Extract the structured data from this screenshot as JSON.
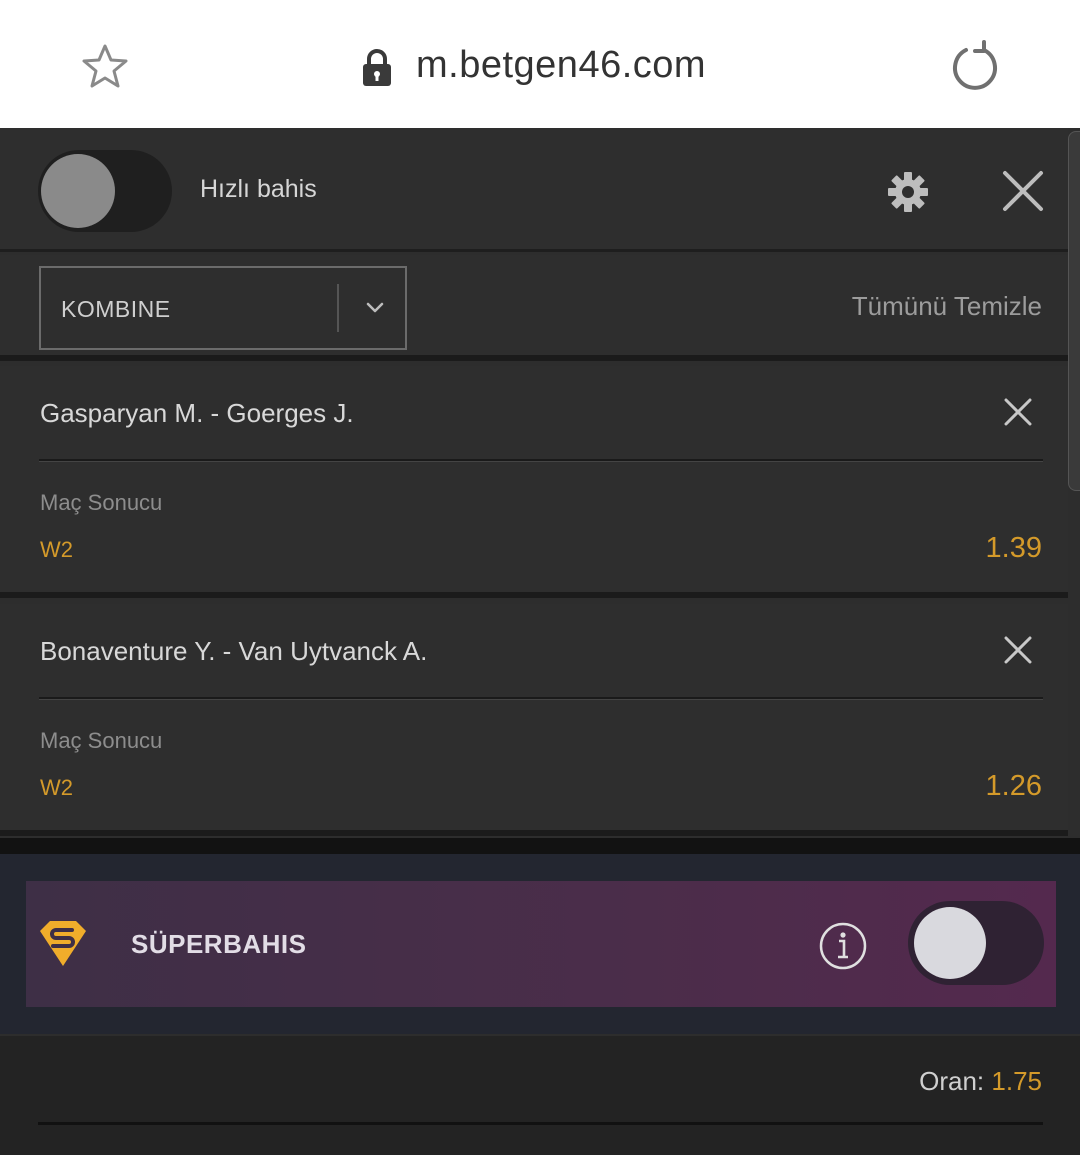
{
  "browser": {
    "url": "m.betgen46.com"
  },
  "betslip": {
    "quick_bet_label": "Hızlı bahis",
    "bet_type": "KOMBINE",
    "clear_all_label": "Tümünü Temizle",
    "bets": [
      {
        "match": "Gasparyan M. - Goerges J.",
        "market": "Maç Sonucu",
        "pick": "W2",
        "odd": "1.39"
      },
      {
        "match": "Bonaventure Y. - Van Uytvanck A.",
        "market": "Maç Sonucu",
        "pick": "W2",
        "odd": "1.26"
      }
    ],
    "superbet": {
      "title": "SÜPERBAHIS"
    },
    "total": {
      "label": "Oran:",
      "value": "1.75"
    }
  },
  "colors": {
    "accent": "#d49a2a",
    "panel": "#2e2e2e",
    "super_gradient_start": "#3e2f46",
    "super_gradient_end": "#54294e"
  }
}
